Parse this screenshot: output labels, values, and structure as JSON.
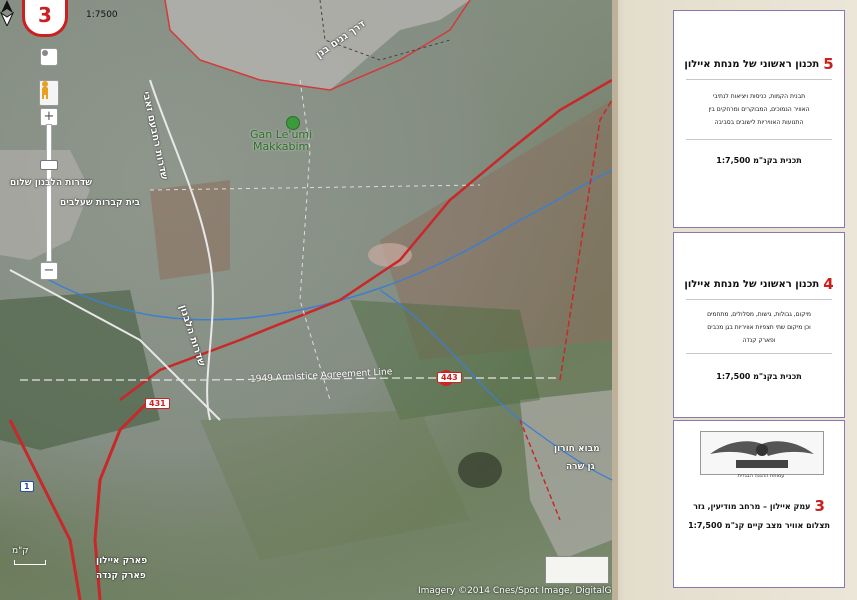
{
  "map": {
    "page_number": "3",
    "scale_text": "1:7500",
    "park_name_line1": "Gan Le'umi",
    "park_name_line2": "Makkabim",
    "street_ganeinu": "דרך גנים בנן",
    "street_rehavam": "שדרות רחבעם זאבי",
    "street_levanon": "שדרות הלבנון",
    "street_levanon_2": "שדרות הלבנון שלום",
    "armistice_line": "1949 Armistice Agreement Line",
    "road_shield_1": "1",
    "road_shield_431": "431",
    "road_shield_443": "443",
    "road_shield_left": "431",
    "kiryat_sheba_label": "בית קברות שעלבים",
    "mevo_horon_label": "מבוא חורון",
    "gan_sheba_label": "גן שרה",
    "ayalon_park_label": "פארק איילון",
    "kanada_park_label": "פארק קנדה",
    "bottom_scale": "ק\"מ",
    "credit": "Imagery ©2014 Cnes/Spot Image, DigitalG",
    "colors": {
      "red_route": "#c8282a",
      "blue_line": "#3c7fd0",
      "trail_white": "#e8e8e8"
    }
  },
  "panel": {
    "card5": {
      "number": "5",
      "title": "תכנון ראשוני של מנחת איילון",
      "desc_lines": [
        "תבנית הקמות, כניסות ויציאות לנתיבי",
        "האוויר הנמוכים, המבוקרים ומרחקים בין",
        "התנועות האוויריות לישובים בסביבה"
      ],
      "scale": "תכנית בקנ\"מ 1:7,500"
    },
    "card4": {
      "number": "4",
      "title": "תכנון ראשוני של מנחת איילון",
      "desc_lines": [
        "מיקום, גבולות, גישות, מסלולים, מתחמים",
        "וכן מיקום שתי תצפיות אוויריות בגן מכבים",
        "ופארק קנדה"
      ],
      "scale": "תכנית בקנ\"מ 1:7,500"
    },
    "card3": {
      "number": "3",
      "logo_caption": "עמותת ההגנה הבגדית",
      "line1": "עמק איילון – מרחב מודיעין, גזר",
      "line2": "תצלום אוויר מצב קיים קנ\"מ 1:7,500"
    }
  }
}
